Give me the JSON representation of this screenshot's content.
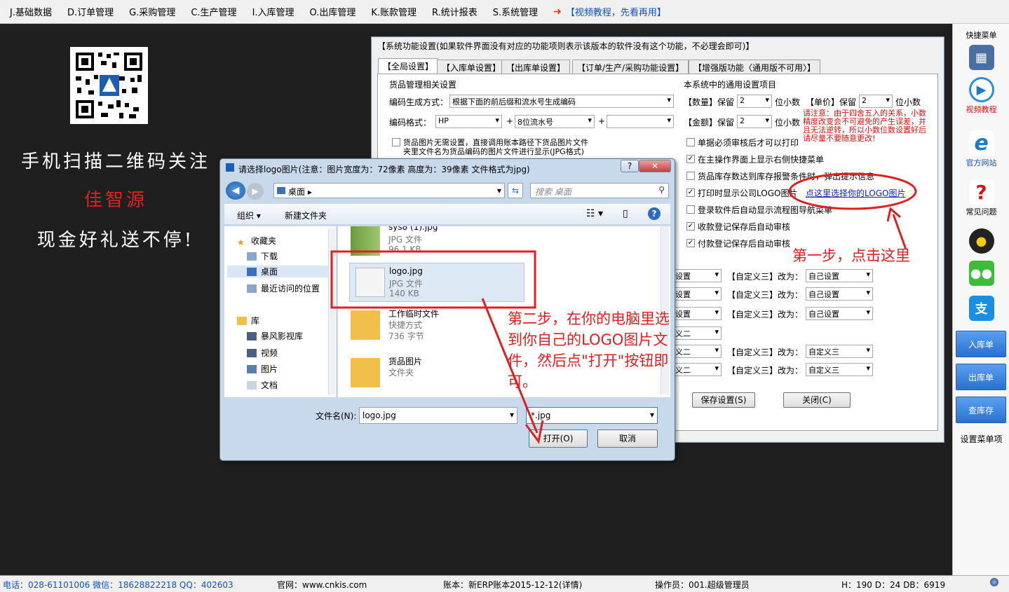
{
  "menu": {
    "items": [
      "J.基础数据",
      "D.订单管理",
      "G.采购管理",
      "C.生产管理",
      "I.入库管理",
      "O.出库管理",
      "K.账款管理",
      "R.统计报表",
      "S.系统管理"
    ],
    "video_link": "【视频教程，先看再用】"
  },
  "promo": {
    "line1": "手机扫描二维码关注",
    "line2": "佳智源",
    "line3": "现金好礼送不停!"
  },
  "sidebar": {
    "title": "快捷菜单",
    "items": [
      "视频教程",
      "官方网站",
      "常见问题"
    ],
    "buttons": [
      "入库单",
      "出库单",
      "查库存"
    ],
    "settings": "设置菜单项"
  },
  "status": {
    "phone": "电话：028-61101006 微信：18628822218 QQ：402603",
    "website": "官网：www.cnkis.com",
    "account": "账本：新ERP账本2015-12-12(详情)",
    "operator": "操作员：001.超级管理员",
    "size": "H：190 D：24 DB：6919"
  },
  "settings": {
    "title": "【系统功能设置(如果软件界面没有对应的功能项则表示该版本的软件没有这个功能，不必理会即可)】",
    "tabs": [
      "【全局设置】",
      "【入库单设置】",
      "【出库单设置】",
      "【订单/生产/采购功能设置】",
      "【增强版功能〈通用版不可用〉】"
    ],
    "goods_group": "货品管理相关设置",
    "code_gen_label": "编码生成方式：",
    "code_gen_value": "根据下面的前后缀和流水号生成编码",
    "code_format_label": "编码格式：",
    "code_prefix": "HP",
    "code_serial": "8位流水号",
    "plus": "+",
    "image_option_1": "货品图片无需设置，直接调用账本路径下货品图片文件",
    "image_option_2": "夹里文件名为货品编码的图片文件进行显示(JPG格式)",
    "common_group": "本系统中的通用设置项目",
    "qty_label": "【数量】保留",
    "qty_value": "2",
    "unit_price_label": "【单价】保留",
    "unit_price_value": "2",
    "amount_label": "【金额】保留",
    "amount_value": "2",
    "decimals": "位小数",
    "warning": "请注意：由于四舍五入的关系，小数精度改变会不可避免的产生误差，并且无法逆转，所以小数位数设置好后请尽量不要随意更改!",
    "checks": [
      "单据必须审核后才可以打印",
      "在主操作界面上显示右侧快捷菜单",
      "货品库存数达到库存报警条件时，弹出提示信息",
      "打印时显示公司LOGO图片",
      "登录软件后自动显示流程图导航菜单",
      "收款登记保存后自动审核",
      "付款登记保存后自动审核"
    ],
    "logo_link": "点这里选择你的LOGO图片",
    "custom_rows": [
      {
        "left": "设置",
        "label": "【自定义三】改为：",
        "value": "自己设置"
      },
      {
        "left": "设置",
        "label": "【自定义三】改为：",
        "value": "自己设置"
      },
      {
        "left": "设置",
        "label": "【自定义三】改为：",
        "value": "自己设置"
      },
      {
        "left": "义二",
        "label": "",
        "value": ""
      },
      {
        "left": "义二",
        "label": "【自定义三】改为：",
        "value": "自定义三"
      },
      {
        "left": "义二",
        "label": "【自定义三】改为：",
        "value": "自定义三"
      }
    ],
    "save_button": "保存设置(S)",
    "close_button": "关闭(C)"
  },
  "annotations": {
    "step1": "第一步，点击这里",
    "step2": "第二步，在你的电脑里选到你自己的LOGO图片文件，然后点\"打开\"按钮即可。"
  },
  "dialog": {
    "title": "请选择logo图片(注意：图片宽度为：72像素 高度为：39像素 文件格式为jpg)",
    "location": "桌面",
    "search_placeholder": "搜索 桌面",
    "organize": "组织",
    "new_folder": "新建文件夹",
    "nav": [
      "收藏夹",
      "下载",
      "桌面",
      "最近访问的位置",
      "库",
      "暴风影视库",
      "视频",
      "图片",
      "文档"
    ],
    "files": [
      {
        "name": "sys8 (1).jpg",
        "type": "JPG 文件",
        "size": "96.1 KB"
      },
      {
        "name": "logo.jpg",
        "type": "JPG 文件",
        "size": "140 KB"
      },
      {
        "name": "工作临时文件",
        "type": "快捷方式",
        "size": "736 字节"
      },
      {
        "name": "货品图片",
        "type": "文件夹",
        "size": ""
      }
    ],
    "filename_label": "文件名(N):",
    "filename_value": "logo.jpg",
    "filter_value": "*.jpg",
    "open_button": "打开(O)",
    "cancel_button": "取消"
  }
}
